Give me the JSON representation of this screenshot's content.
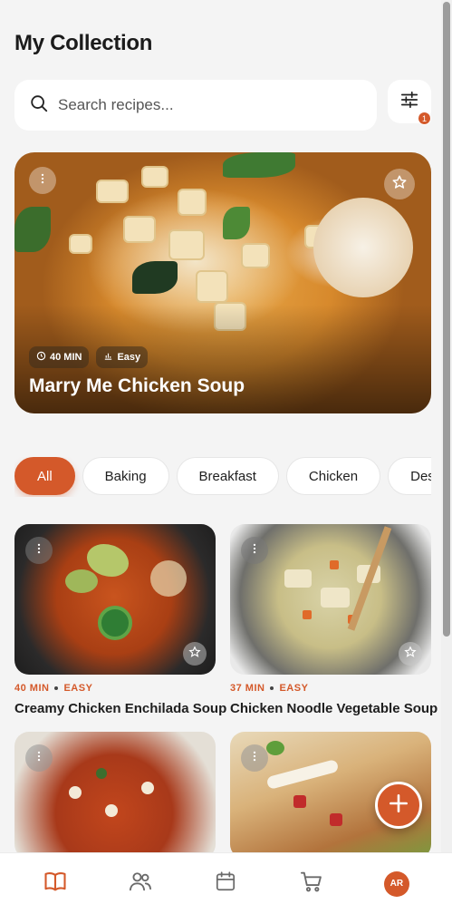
{
  "header": {
    "title": "My Collection"
  },
  "search": {
    "placeholder": "Search recipes..."
  },
  "filter": {
    "badge_count": "1"
  },
  "featured": {
    "time": "40 MIN",
    "difficulty": "Easy",
    "title": "Marry Me Chicken Soup"
  },
  "categories": [
    "All",
    "Baking",
    "Breakfast",
    "Chicken",
    "Desserts"
  ],
  "recipes": [
    {
      "time": "40 MIN",
      "difficulty": "EASY",
      "title": "Creamy Chicken Enchilada Soup"
    },
    {
      "time": "37 MIN",
      "difficulty": "EASY",
      "title": "Chicken Noodle Vegetable Soup"
    }
  ],
  "user": {
    "initials": "AR"
  },
  "colors": {
    "accent": "#d4592a",
    "background": "#f4f4f4"
  }
}
